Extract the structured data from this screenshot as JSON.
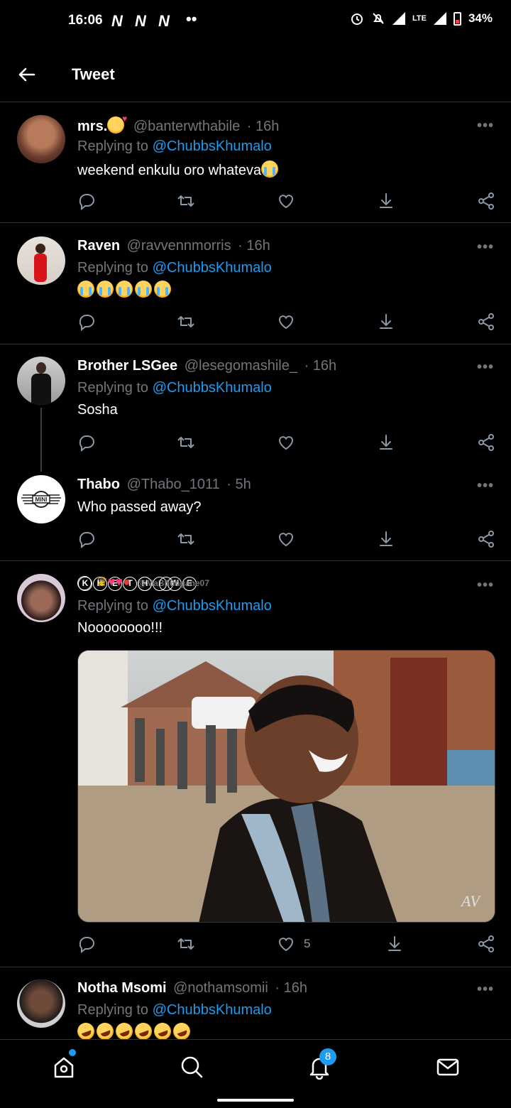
{
  "status_bar": {
    "time": "16:06",
    "network": "LTE",
    "battery": "34%"
  },
  "header": {
    "title": "Tweet"
  },
  "tweets": [
    {
      "name": "mrs.",
      "handle": "@banterwthabile",
      "time": "· 16h",
      "replying_prefix": "Replying to",
      "replying_to": "@ChubbsKhumalo",
      "text": "weekend enkulu oro whateva"
    },
    {
      "name": "Raven",
      "handle": "@ravvennmorris",
      "time": "· 16h",
      "replying_prefix": "Replying to",
      "replying_to": "@ChubbsKhumalo",
      "text": ""
    },
    {
      "name": "Brother LSGee",
      "handle": "@lesegomashile_",
      "time": "· 16h",
      "replying_prefix": "Replying to",
      "replying_to": "@ChubbsKhumalo",
      "text": "Sosha"
    },
    {
      "name": "Thabo",
      "handle": "@Thabo_1011",
      "time": "· 5h",
      "text": "Who passed away?",
      "avatar_text": "MINI"
    },
    {
      "name_letters": [
        "K",
        "H",
        "E",
        "T",
        "H",
        "I",
        "W",
        "E"
      ],
      "handle": "@MaBhungane07",
      "time": "· 16h",
      "replying_prefix": "Replying to",
      "replying_to": "@ChubbsKhumalo",
      "text": "Noooooooo!!!",
      "likes": "5",
      "image_watermark": "AV"
    },
    {
      "name": "Notha Msomi",
      "handle": "@nothamsomii",
      "time": "· 16h",
      "replying_prefix": "Replying to",
      "replying_to": "@ChubbsKhumalo",
      "text": ""
    }
  ],
  "more_label": "•••",
  "nav": {
    "notifications_badge": "8"
  },
  "colors": {
    "accent": "#1d9bf0",
    "background": "#000000",
    "muted": "#71767b"
  }
}
